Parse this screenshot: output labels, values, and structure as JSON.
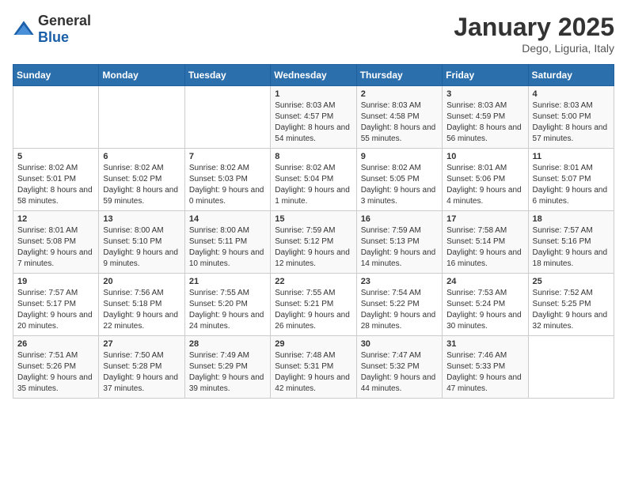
{
  "logo": {
    "general": "General",
    "blue": "Blue"
  },
  "title": "January 2025",
  "location": "Dego, Liguria, Italy",
  "weekdays": [
    "Sunday",
    "Monday",
    "Tuesday",
    "Wednesday",
    "Thursday",
    "Friday",
    "Saturday"
  ],
  "weeks": [
    [
      {
        "day": "",
        "sunrise": "",
        "sunset": "",
        "daylight": ""
      },
      {
        "day": "",
        "sunrise": "",
        "sunset": "",
        "daylight": ""
      },
      {
        "day": "",
        "sunrise": "",
        "sunset": "",
        "daylight": ""
      },
      {
        "day": "1",
        "sunrise": "8:03 AM",
        "sunset": "4:57 PM",
        "daylight": "8 hours and 54 minutes."
      },
      {
        "day": "2",
        "sunrise": "8:03 AM",
        "sunset": "4:58 PM",
        "daylight": "8 hours and 55 minutes."
      },
      {
        "day": "3",
        "sunrise": "8:03 AM",
        "sunset": "4:59 PM",
        "daylight": "8 hours and 56 minutes."
      },
      {
        "day": "4",
        "sunrise": "8:03 AM",
        "sunset": "5:00 PM",
        "daylight": "8 hours and 57 minutes."
      }
    ],
    [
      {
        "day": "5",
        "sunrise": "8:02 AM",
        "sunset": "5:01 PM",
        "daylight": "8 hours and 58 minutes."
      },
      {
        "day": "6",
        "sunrise": "8:02 AM",
        "sunset": "5:02 PM",
        "daylight": "8 hours and 59 minutes."
      },
      {
        "day": "7",
        "sunrise": "8:02 AM",
        "sunset": "5:03 PM",
        "daylight": "9 hours and 0 minutes."
      },
      {
        "day": "8",
        "sunrise": "8:02 AM",
        "sunset": "5:04 PM",
        "daylight": "9 hours and 1 minute."
      },
      {
        "day": "9",
        "sunrise": "8:02 AM",
        "sunset": "5:05 PM",
        "daylight": "9 hours and 3 minutes."
      },
      {
        "day": "10",
        "sunrise": "8:01 AM",
        "sunset": "5:06 PM",
        "daylight": "9 hours and 4 minutes."
      },
      {
        "day": "11",
        "sunrise": "8:01 AM",
        "sunset": "5:07 PM",
        "daylight": "9 hours and 6 minutes."
      }
    ],
    [
      {
        "day": "12",
        "sunrise": "8:01 AM",
        "sunset": "5:08 PM",
        "daylight": "9 hours and 7 minutes."
      },
      {
        "day": "13",
        "sunrise": "8:00 AM",
        "sunset": "5:10 PM",
        "daylight": "9 hours and 9 minutes."
      },
      {
        "day": "14",
        "sunrise": "8:00 AM",
        "sunset": "5:11 PM",
        "daylight": "9 hours and 10 minutes."
      },
      {
        "day": "15",
        "sunrise": "7:59 AM",
        "sunset": "5:12 PM",
        "daylight": "9 hours and 12 minutes."
      },
      {
        "day": "16",
        "sunrise": "7:59 AM",
        "sunset": "5:13 PM",
        "daylight": "9 hours and 14 minutes."
      },
      {
        "day": "17",
        "sunrise": "7:58 AM",
        "sunset": "5:14 PM",
        "daylight": "9 hours and 16 minutes."
      },
      {
        "day": "18",
        "sunrise": "7:57 AM",
        "sunset": "5:16 PM",
        "daylight": "9 hours and 18 minutes."
      }
    ],
    [
      {
        "day": "19",
        "sunrise": "7:57 AM",
        "sunset": "5:17 PM",
        "daylight": "9 hours and 20 minutes."
      },
      {
        "day": "20",
        "sunrise": "7:56 AM",
        "sunset": "5:18 PM",
        "daylight": "9 hours and 22 minutes."
      },
      {
        "day": "21",
        "sunrise": "7:55 AM",
        "sunset": "5:20 PM",
        "daylight": "9 hours and 24 minutes."
      },
      {
        "day": "22",
        "sunrise": "7:55 AM",
        "sunset": "5:21 PM",
        "daylight": "9 hours and 26 minutes."
      },
      {
        "day": "23",
        "sunrise": "7:54 AM",
        "sunset": "5:22 PM",
        "daylight": "9 hours and 28 minutes."
      },
      {
        "day": "24",
        "sunrise": "7:53 AM",
        "sunset": "5:24 PM",
        "daylight": "9 hours and 30 minutes."
      },
      {
        "day": "25",
        "sunrise": "7:52 AM",
        "sunset": "5:25 PM",
        "daylight": "9 hours and 32 minutes."
      }
    ],
    [
      {
        "day": "26",
        "sunrise": "7:51 AM",
        "sunset": "5:26 PM",
        "daylight": "9 hours and 35 minutes."
      },
      {
        "day": "27",
        "sunrise": "7:50 AM",
        "sunset": "5:28 PM",
        "daylight": "9 hours and 37 minutes."
      },
      {
        "day": "28",
        "sunrise": "7:49 AM",
        "sunset": "5:29 PM",
        "daylight": "9 hours and 39 minutes."
      },
      {
        "day": "29",
        "sunrise": "7:48 AM",
        "sunset": "5:31 PM",
        "daylight": "9 hours and 42 minutes."
      },
      {
        "day": "30",
        "sunrise": "7:47 AM",
        "sunset": "5:32 PM",
        "daylight": "9 hours and 44 minutes."
      },
      {
        "day": "31",
        "sunrise": "7:46 AM",
        "sunset": "5:33 PM",
        "daylight": "9 hours and 47 minutes."
      },
      {
        "day": "",
        "sunrise": "",
        "sunset": "",
        "daylight": ""
      }
    ]
  ]
}
